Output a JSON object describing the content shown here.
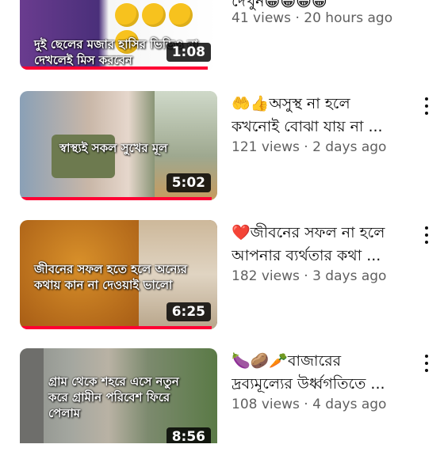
{
  "videos": [
    {
      "title_line1": "দেখুন😁😁😁😁",
      "title_line2": "",
      "views": "41 views",
      "age": "20 hours ago",
      "duration": "1:08",
      "overlay": "দুই ছেলের মজার হাসির ভিডিও না দেখলেই মিস করবেন",
      "progress": 0.95
    },
    {
      "title_line1": "🤲👍অসুস্থ না হলে",
      "title_line2": "কখনোই বোঝা যায় না ...",
      "views": "121 views",
      "age": "2 days ago",
      "duration": "5:02",
      "overlay": "স্বাস্থ্যই সকল সুখের মূল",
      "progress": 0.97
    },
    {
      "title_line1": "❤️জীবনের সফল না হলে",
      "title_line2": "আপনার ব্যর্থতার কথা ...",
      "views": "182 views",
      "age": "3 days ago",
      "duration": "6:25",
      "overlay": "জীবনের সফল হতে হলে অন্যের কথায় কান না দেওয়াই ভালো",
      "progress": 0.97
    },
    {
      "title_line1": "🍆🥔🥕বাজারের",
      "title_line2": "দ্রব্যমূল্যের উর্ধ্বগতিতে ...",
      "views": "108 views",
      "age": "4 days ago",
      "duration": "8:56",
      "overlay": "গ্রাম থেকে শহরে এসে নতুন করে গ্রামীন পরিবেশ ফিরে পেলাম",
      "progress": 0
    }
  ],
  "meta_separator": "·",
  "colors": {
    "progress": "#ff0033",
    "meta": "#606060",
    "title": "#0f0f0f"
  }
}
